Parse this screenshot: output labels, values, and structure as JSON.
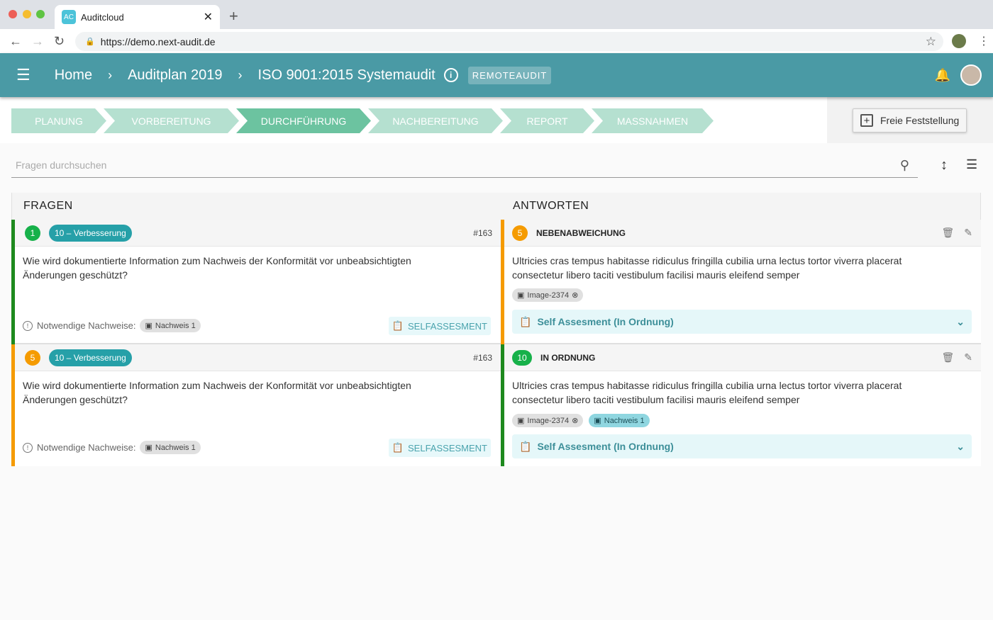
{
  "browser": {
    "tab_title": "Auditcloud",
    "favicon": "AC",
    "url": "https://demo.next-audit.de"
  },
  "header": {
    "breadcrumbs": [
      "Home",
      "Auditplan 2019",
      "ISO 9001:2015 Systemaudit"
    ],
    "badge": "REMOTEAUDIT"
  },
  "steps": [
    "PLANUNG",
    "VORBEREITUNG",
    "DURCHFÜHRUNG",
    "NACHBEREITUNG",
    "REPORT",
    "MASSNAHMEN"
  ],
  "active_step": "DURCHFÜHRUNG",
  "free_button": "Freie Feststellung",
  "search": {
    "placeholder": "Fragen durchsuchen"
  },
  "columns": {
    "questions": "FRAGEN",
    "answers": "ANTWORTEN"
  },
  "colors": {
    "teal": "#4a9aa5",
    "green": "#1e8a1e",
    "orange": "#f59b00"
  },
  "rows": [
    {
      "q": {
        "num": "1",
        "category": "10 – Verbesserung",
        "id": "#163",
        "text": "Wie wird dokumentierte Information zum Nachweis der Konformität vor unbeabsichtigten Änderungen geschützt?",
        "evidence_label": "Notwendige Nachweise:",
        "evidence": "Nachweis 1",
        "self_btn": "SELFASSESMENT"
      },
      "a": {
        "num": "5",
        "status": "NEBENABWEICHUNG",
        "text": "Ultricies cras tempus habitasse ridiculus fringilla cubilia urna lectus tortor viverra placerat consectetur libero taciti vestibulum facilisi mauris eleifend semper",
        "attachments": [
          "Image-2374"
        ],
        "assessment": "Self Assesment (In Ordnung)"
      }
    },
    {
      "q": {
        "num": "5",
        "category": "10 – Verbesserung",
        "id": "#163",
        "text": "Wie wird dokumentierte Information zum Nachweis der Konformität vor unbeabsichtigten Änderungen geschützt?",
        "evidence_label": "Notwendige Nachweise:",
        "evidence": "Nachweis 1",
        "self_btn": "SELFASSESMENT"
      },
      "a": {
        "num": "10",
        "status": "IN ORDNUNG",
        "text": "Ultricies cras tempus habitasse ridiculus fringilla cubilia urna lectus tortor viverra placerat consectetur libero taciti vestibulum facilisi mauris eleifend semper",
        "attachments": [
          "Image-2374",
          "Nachweis 1"
        ],
        "assessment": "Self Assesment (In Ordnung)"
      }
    }
  ]
}
